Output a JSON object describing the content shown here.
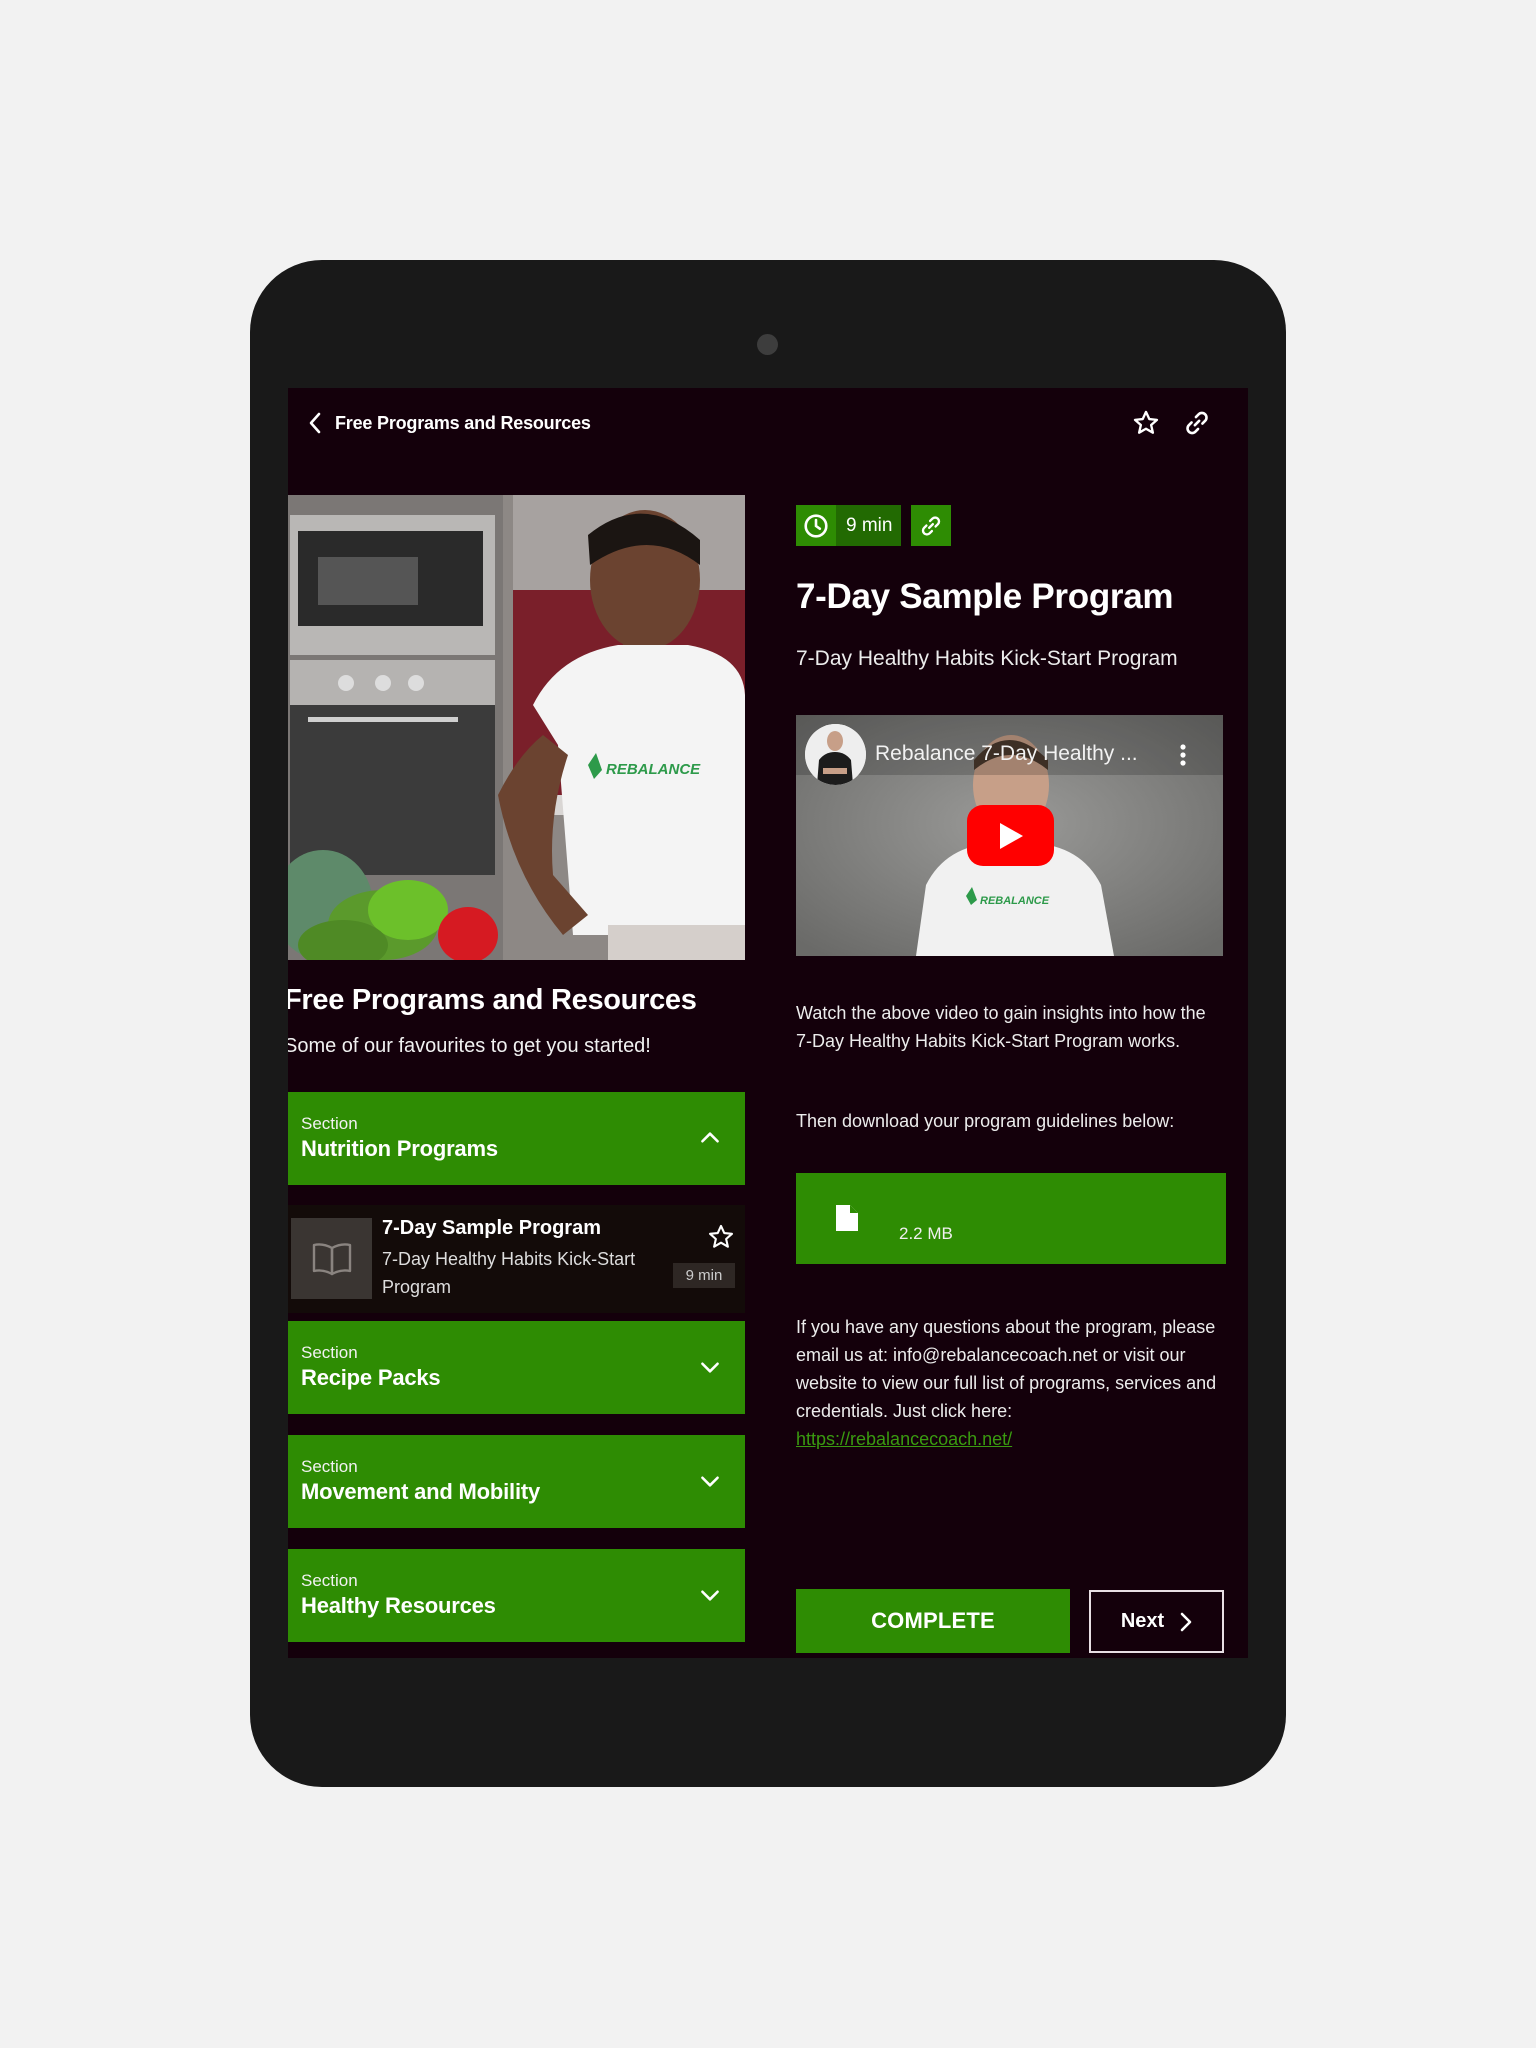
{
  "header": {
    "back_icon": "chevron-left-icon",
    "title": "Free Programs and Resources",
    "favorite_icon": "star-outline-icon",
    "link_icon": "link-icon"
  },
  "left_panel": {
    "hero_image": "woman-cooking-kitchen-rebalance-shirt",
    "hero_shirt_logo": "REBALANCE",
    "title": "Free Programs and Resources",
    "subtitle": "Some of our favourites to get you started!",
    "sections": [
      {
        "label": "Section",
        "title": "Nutrition Programs",
        "expanded": true,
        "icon": "chevron-up-icon"
      },
      {
        "label": "Section",
        "title": "Recipe Packs",
        "expanded": false,
        "icon": "chevron-down-icon"
      },
      {
        "label": "Section",
        "title": "Movement and Mobility",
        "expanded": false,
        "icon": "chevron-down-icon"
      },
      {
        "label": "Section",
        "title": "Healthy Resources",
        "expanded": false,
        "icon": "chevron-down-icon"
      }
    ],
    "lesson": {
      "icon": "book-open-icon",
      "title": "7-Day Sample Program",
      "subtitle": "7-Day Healthy Habits Kick-Start Program",
      "duration": "9 min",
      "favorite_icon": "star-outline-icon"
    }
  },
  "content": {
    "duration_badge": "9 min",
    "duration_icon": "clock-icon",
    "link_badge_icon": "link-icon",
    "title": "7-Day Sample Program",
    "subtitle": "7-Day Healthy Habits Kick-Start Program",
    "video": {
      "title": "Rebalance 7-Day Healthy ...",
      "shirt_logo": "REBALANCE",
      "play_icon": "youtube-play-icon",
      "more_icon": "more-vertical-icon"
    },
    "paragraph1": "Watch the above video to gain insights into how the 7-Day Healthy Habits Kick-Start Program works.",
    "paragraph2": "Then download your program guidelines below:",
    "download": {
      "icon": "file-icon",
      "size": "2.2 MB"
    },
    "contact_text": "If you have any questions about the program, please email us at: info@rebalancecoach.net or visit our website to view our full list of programs, services and credentials. Just click here:",
    "contact_link": "https://rebalancecoach.net/",
    "complete_label": "COMPLETE",
    "next_label": "Next",
    "next_icon": "chevron-right-icon"
  },
  "colors": {
    "accent_green": "#2e8c03",
    "dark_green": "#226a02",
    "screen_bg": "#14000b",
    "device_frame": "#191919",
    "page_bg": "#f2f2f2",
    "link_green": "#3a9a10",
    "youtube_red": "#ff0000"
  }
}
